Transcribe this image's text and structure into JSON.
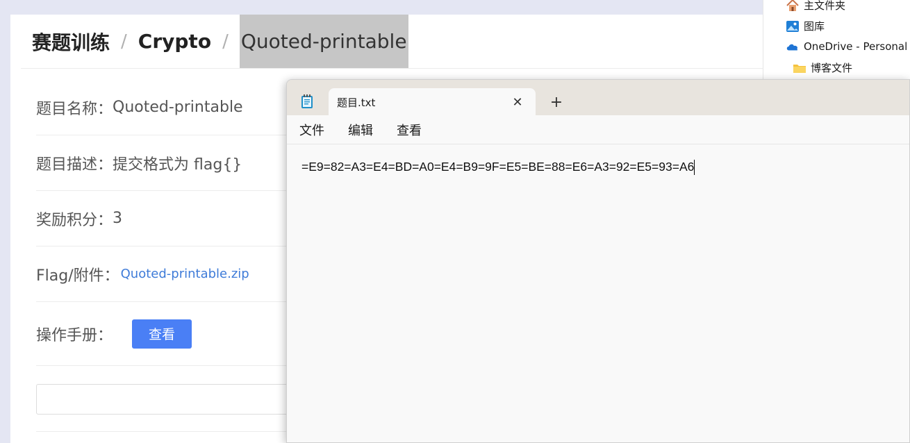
{
  "web": {
    "breadcrumb": {
      "items": [
        "赛题训练",
        "Crypto",
        "Quoted-printable"
      ],
      "separator": "/"
    },
    "fields": {
      "name_label": "题目名称：",
      "name_value": "Quoted-printable",
      "desc_label": "题目描述：",
      "desc_value": "提交格式为 flag{}",
      "score_label": "奖励积分：",
      "score_value": "3",
      "attachment_label": "Flag/附件：",
      "attachment_link": "Quoted-printable.zip",
      "manual_label": "操作手册：",
      "manual_button": "查看"
    },
    "flag_input": {
      "value": "",
      "placeholder": ""
    },
    "colors": {
      "link": "#3e7bd8",
      "button": "#4a7ff5"
    }
  },
  "explorer": {
    "items": [
      {
        "label": "主文件夹",
        "icon": "home-icon"
      },
      {
        "label": "图库",
        "icon": "gallery-icon"
      },
      {
        "label": "OneDrive - Personal",
        "icon": "onedrive-cloud-icon"
      },
      {
        "label": "博客文件",
        "icon": "folder-icon"
      }
    ]
  },
  "notepad": {
    "tab_title": "题目.txt",
    "close_symbol": "✕",
    "newtab_symbol": "+",
    "menu": [
      "文件",
      "编辑",
      "查看"
    ],
    "content": "=E9=82=A3=E4=BD=A0=E4=B9=9F=E5=BE=88=E6=A3=92=E5=93=A6"
  }
}
